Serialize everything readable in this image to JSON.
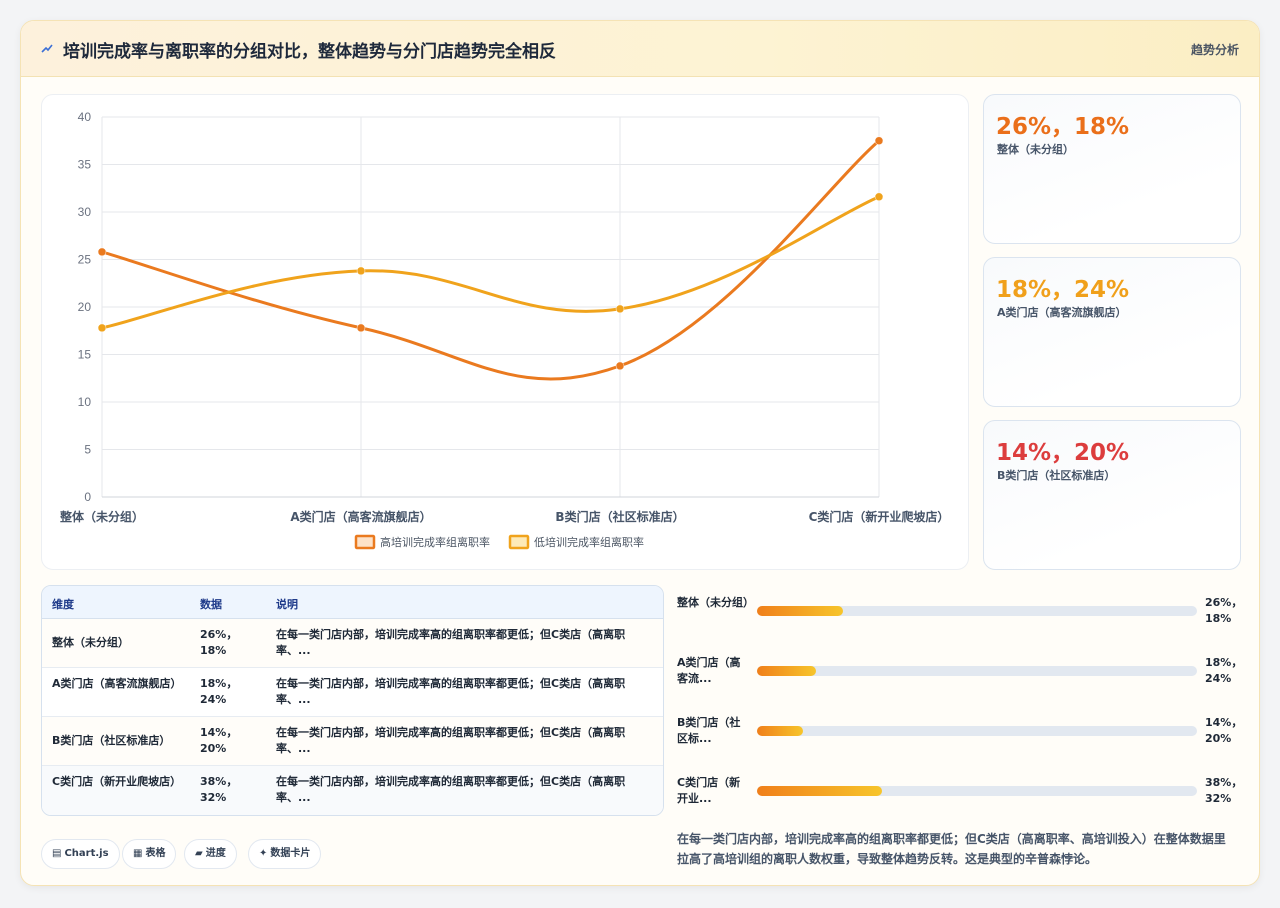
{
  "header": {
    "title": "培训完成率与离职率的分组对比，整体趋势与分门店趋势完全相反",
    "action": "趋势分析"
  },
  "chart_data": {
    "type": "line",
    "categories": [
      "整体（未分组）",
      "A类门店（高客流旗舰店）",
      "B类门店（社区标准店）",
      "C类门店（新开业爬坡店）"
    ],
    "series": [
      {
        "name": "高培训完成率组离职率",
        "values": [
          25.8,
          17.8,
          13.8,
          37.5
        ],
        "color": "#ea7a1f"
      },
      {
        "name": "低培训完成率组离职率",
        "values": [
          17.8,
          23.8,
          19.8,
          31.6
        ],
        "color": "#f0a31c"
      }
    ],
    "ylim": [
      0,
      40
    ],
    "yticks": [
      "0",
      "5",
      "10",
      "15",
      "20",
      "25",
      "30",
      "35",
      "40"
    ],
    "grid": true,
    "legend": "bottom"
  },
  "stats": [
    {
      "value": "26%，18%",
      "label": "整体（未分组）",
      "color": "#ea6f1a"
    },
    {
      "value": "18%，24%",
      "label": "A类门店（高客流旗舰店）",
      "color": "#f0a01b"
    },
    {
      "value": "14%，20%",
      "label": "B类门店（社区标准店）",
      "color": "#dc3d3d"
    }
  ],
  "table": {
    "headers": [
      "维度",
      "数据",
      "说明"
    ],
    "rows": [
      {
        "dim": "整体（未分组）",
        "data": "26%，18%",
        "desc": "在每一类门店内部，培训完成率高的组离职率都更低；但C类店（高离职率、..."
      },
      {
        "dim": "A类门店（高客流旗舰店）",
        "data": "18%，24%",
        "desc": "在每一类门店内部，培训完成率高的组离职率都更低；但C类店（高离职率、..."
      },
      {
        "dim": "B类门店（社区标准店）",
        "data": "14%，20%",
        "desc": "在每一类门店内部，培训完成率高的组离职率都更低；但C类店（高离职率、..."
      },
      {
        "dim": "C类门店（新开业爬坡店）",
        "data": "38%，32%",
        "desc": "在每一类门店内部，培训完成率高的组离职率都更低；但C类店（高离职率、..."
      }
    ]
  },
  "progress": [
    {
      "name": "整体（未分组）",
      "short": "整体（未分组）",
      "value": "26%，18%",
      "fill": 0.195
    },
    {
      "name": "A类门店（高客流旗舰店）",
      "short": "A类门店（高客流...",
      "value": "18%，24%",
      "fill": 0.135
    },
    {
      "name": "B类门店（社区标准店）",
      "short": "B类门店（社区标...",
      "value": "14%，20%",
      "fill": 0.105
    },
    {
      "name": "C类门店（新开业爬坡店）",
      "short": "C类门店（新开业...",
      "value": "38%，32%",
      "fill": 0.285
    }
  ],
  "conclusion": "在每一类门店内部，培训完成率高的组离职率都更低；但C类店（高离职率、高培训投入）在整体数据里拉高了高培训组的离职人数权重，导致整体趋势反转。这是典型的辛普森悖论。",
  "chips": [
    {
      "icon": "▤",
      "label": "Chart.js"
    },
    {
      "icon": "▦",
      "label": "表格"
    },
    {
      "icon": "▰",
      "label": "进度"
    },
    {
      "icon": "✦",
      "label": "数据卡片"
    }
  ]
}
